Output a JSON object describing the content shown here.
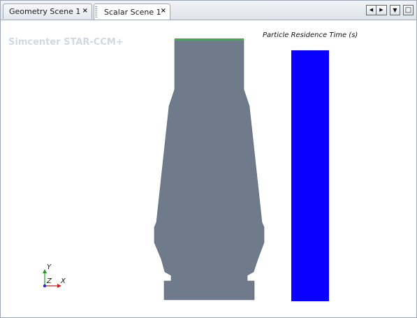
{
  "tabs": [
    {
      "label": "Geometry Scene 1",
      "close": "×",
      "active": false
    },
    {
      "label": "Scalar Scene 1",
      "close": "×",
      "active": true
    }
  ],
  "window_controls": {
    "prev_icon": "◀",
    "next_icon": "▶",
    "menu_icon": "▼",
    "maximize_icon": "□"
  },
  "scene": {
    "watermark": "Simcenter STAR-CCM+",
    "legend_title": "Particle Residence Time (s)",
    "legend_color": "#0a00ff",
    "geometry_color": "#6f7b8b",
    "inlet_color": "#3fae49",
    "axes": {
      "y": "Y",
      "z": "Z",
      "x": "X",
      "y_color": "#1f9a2a",
      "x_color": "#d01f1f",
      "z_color": "#1f2fd0"
    }
  }
}
